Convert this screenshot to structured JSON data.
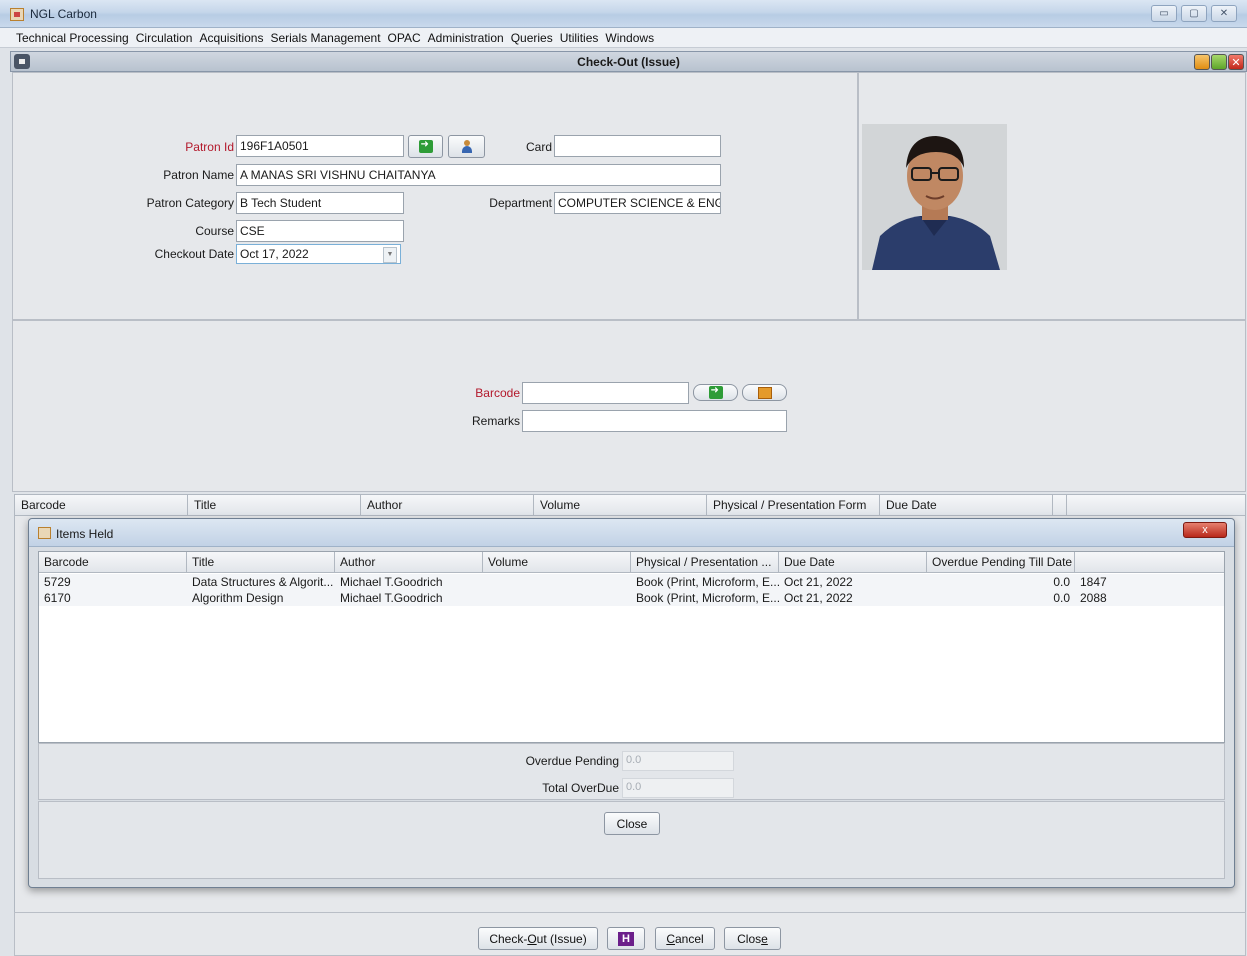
{
  "app": {
    "title": "NGL Carbon"
  },
  "menu": [
    "Technical Processing",
    "Circulation",
    "Acquisitions",
    "Serials Management",
    "OPAC",
    "Administration",
    "Queries",
    "Utilities",
    "Windows"
  ],
  "frame": {
    "title": "Check-Out (Issue)"
  },
  "patron": {
    "id_label": "Patron Id",
    "id_value": "196F1A0501",
    "card_label": "Card",
    "card_value": "",
    "name_label": "Patron Name",
    "name_value": "A MANAS SRI VISHNU CHAITANYA",
    "category_label": "Patron Category",
    "category_value": "B Tech Student",
    "department_label": "Department",
    "department_value": "COMPUTER SCIENCE & ENG",
    "course_label": "Course",
    "course_value": "CSE",
    "checkout_label": "Checkout Date",
    "checkout_value": "Oct 17, 2022"
  },
  "item": {
    "barcode_label": "Barcode",
    "barcode_value": "",
    "remarks_label": "Remarks",
    "remarks_value": ""
  },
  "main_table": {
    "headers": [
      "Barcode",
      "Title",
      "Author",
      "Volume",
      "Physical / Presentation Form",
      "Due Date"
    ]
  },
  "dialog": {
    "title": "Items Held",
    "close_glyph": "x",
    "headers": [
      "Barcode",
      "Title",
      "Author",
      "Volume",
      "Physical / Presentation ...",
      "Due Date",
      "Overdue Pending Till Date"
    ],
    "rows": [
      {
        "barcode": "5729",
        "title": "Data Structures & Algorit...",
        "author": "Michael T.Goodrich",
        "volume": "",
        "form": "Book (Print, Microform, E...",
        "due": "Oct 21, 2022",
        "overdue": "0.0",
        "extra": "1847"
      },
      {
        "barcode": "6170",
        "title": "Algorithm Design",
        "author": "Michael T.Goodrich",
        "volume": "",
        "form": "Book (Print, Microform, E...",
        "due": "Oct 21, 2022",
        "overdue": "0.0",
        "extra": "2088"
      }
    ],
    "overdue_pending_label": "Overdue Pending",
    "overdue_pending_value": "0.0",
    "total_overdue_label": "Total OverDue",
    "total_overdue_value": "0.0",
    "close_label": "Close"
  },
  "actions": {
    "checkout_label_pre": "Check-",
    "checkout_label_mn": "O",
    "checkout_label_post": "ut (Issue)",
    "h_glyph": "H",
    "cancel_mn": "C",
    "cancel_post": "ancel",
    "close_pre": "Clos",
    "close_mn": "e"
  }
}
